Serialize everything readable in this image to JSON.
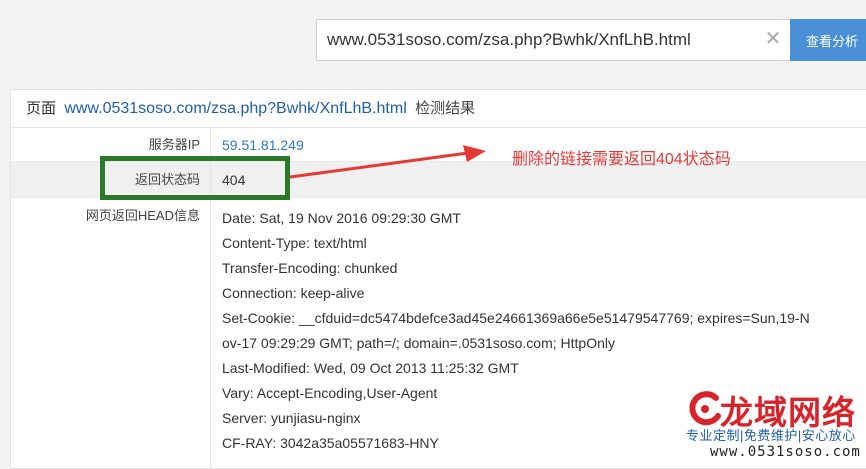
{
  "search": {
    "value": "www.0531soso.com/zsa.php?Bwhk/XnfLhB.html",
    "clear_icon": "✕",
    "button_label": "查看分析"
  },
  "panel": {
    "header_prefix": "页面",
    "header_url": "www.0531soso.com/zsa.php?Bwhk/XnfLhB.html",
    "header_suffix": "检测结果",
    "rows": [
      {
        "label": "服务器IP",
        "value": "59.51.81.249"
      },
      {
        "label": "返回状态码",
        "value": "404"
      },
      {
        "label": "网页返回HEAD信息"
      }
    ],
    "head_lines": [
      "Date: Sat, 19 Nov 2016 09:29:30 GMT",
      "Content-Type: text/html",
      "Transfer-Encoding: chunked",
      "Connection: keep-alive",
      "Set-Cookie: __cfduid=dc5474bdefce3ad45e24661369a66e5e51479547769; expires=Sun,19-N",
      "ov-17 09:29:29 GMT; path=/; domain=.0531soso.com; HttpOnly",
      "Last-Modified: Wed, 09 Oct 2013 11:25:32 GMT",
      "Vary: Accept-Encoding,User-Agent",
      "Server: yunjiasu-nginx",
      "CF-RAY: 3042a35a05571683-HNY"
    ]
  },
  "annotation": {
    "text": "删除的链接需要返回404状态码",
    "color": "#e53935",
    "box_color": "#2a7a2a"
  },
  "watermark": {
    "title": "龙域网络",
    "slogan": "专业定制|免费维护|安心放心",
    "url": "www.0531soso.com",
    "icon": "logo-swirl-icon"
  },
  "colors": {
    "accent": "#4a90d9",
    "link": "#1f5fa8",
    "brand_red": "#d8232a"
  }
}
